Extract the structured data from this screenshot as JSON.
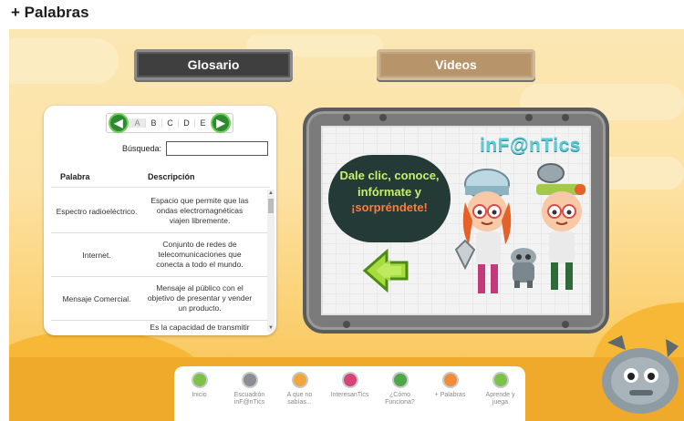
{
  "header": {
    "title": "+ Palabras"
  },
  "tabs": {
    "glosario": "Glosario",
    "videos": "Videos"
  },
  "glossary": {
    "letters": [
      "A",
      "B",
      "C",
      "D",
      "E"
    ],
    "active_letter": "A",
    "search_label": "Búsqueda:",
    "search_value": "",
    "columns": {
      "word": "Palabra",
      "description": "Descripción"
    },
    "rows": [
      {
        "word": "Espectro radioeléctrico.",
        "description": "Espacio que permite que las ondas electromagnéticas viajen libremente."
      },
      {
        "word": "Internet.",
        "description": "Conjunto de redes de telecomunicaciones que conecta a todo el mundo."
      },
      {
        "word": "Mensaje Comercial.",
        "description": "Mensaje al público con el objetivo de presentar y vender un producto."
      },
      {
        "word": "",
        "description": "Es la capacidad de transmitir"
      }
    ]
  },
  "video": {
    "brand": "inF@nTics",
    "bubble_line1": "Dale clic, conoce,",
    "bubble_line2": "infórmate y",
    "bubble_line3": "¡sorpréndete!"
  },
  "dock": {
    "items": [
      {
        "label": "Inicio",
        "color": "#7cc24a"
      },
      {
        "label": "Escuadrón inF@nTics",
        "color": "#8a8f96"
      },
      {
        "label": "A que no sabías...",
        "color": "#f1a53a"
      },
      {
        "label": "InteresanTics",
        "color": "#d6457a"
      },
      {
        "label": "¿Cómo Funciona?",
        "color": "#4ea84a"
      },
      {
        "label": "+ Palabras",
        "color": "#f08d38"
      },
      {
        "label": "Aprende y juega",
        "color": "#7cc24a"
      }
    ]
  },
  "colors": {
    "accent_green": "#2f8a2f",
    "bubble": "#233a36",
    "bubble_text": "#c9f06a"
  }
}
